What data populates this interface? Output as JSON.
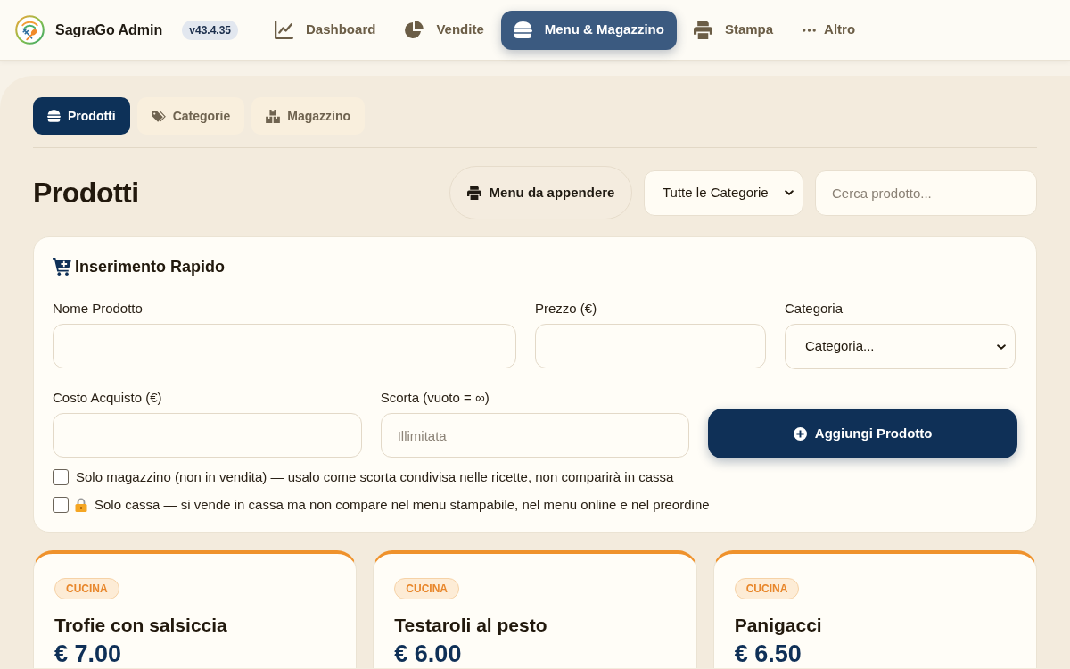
{
  "header": {
    "app_name": "SagraGo Admin",
    "version": "v43.4.35",
    "nav": [
      {
        "label": "Dashboard",
        "kind": "chart",
        "selected": false
      },
      {
        "label": "Vendite",
        "kind": "pie",
        "selected": false
      },
      {
        "label": "Menu & Magazzino",
        "kind": "burger",
        "selected": true
      },
      {
        "label": "Stampa",
        "kind": "printer",
        "selected": false
      },
      {
        "label": "Altro",
        "kind": "dots",
        "selected": false
      }
    ]
  },
  "subtabs": [
    {
      "label": "Prodotti",
      "kind": "burger",
      "selected": true
    },
    {
      "label": "Categorie",
      "kind": "tags",
      "selected": false
    },
    {
      "label": "Magazzino",
      "kind": "boxes",
      "selected": false
    }
  ],
  "page_title": "Prodotti",
  "toolbar": {
    "print_button": "Menu da appendere",
    "category_filter": "Tutte le Categorie",
    "search": {
      "placeholder": "Cerca prodotto..."
    }
  },
  "quick_add": {
    "title": "Inserimento Rapido",
    "fields": [
      {
        "label": "Nome Prodotto",
        "kind": "input"
      },
      {
        "label": "Prezzo (€)",
        "kind": "input"
      },
      {
        "label": "Categoria",
        "kind": "select",
        "value": "Categoria..."
      },
      {
        "label": "Costo Acquisto (€)",
        "kind": "input"
      },
      {
        "label": "Scorta (vuoto = ∞)",
        "kind": "input",
        "placeholder": "Illimitata"
      }
    ],
    "add_button": "Aggiungi Prodotto",
    "options": [
      {
        "label": "Solo magazzino (non in vendita) — usalo come scorta condivisa nelle ricette, non comparirà in cassa",
        "locked": false,
        "checked": false
      },
      {
        "label": "Solo cassa — si vende in cassa ma non compare nel menu stampabile, nel menu online e nel preordine",
        "locked": true,
        "checked": false
      }
    ]
  },
  "products": [
    {
      "category": "CUCINA",
      "name": "Trofie con salsiccia",
      "price": "€ 7.00"
    },
    {
      "category": "CUCINA",
      "name": "Testaroli al pesto",
      "price": "€ 6.00"
    },
    {
      "category": "CUCINA",
      "name": "Panigacci",
      "price": "€ 6.50"
    }
  ]
}
